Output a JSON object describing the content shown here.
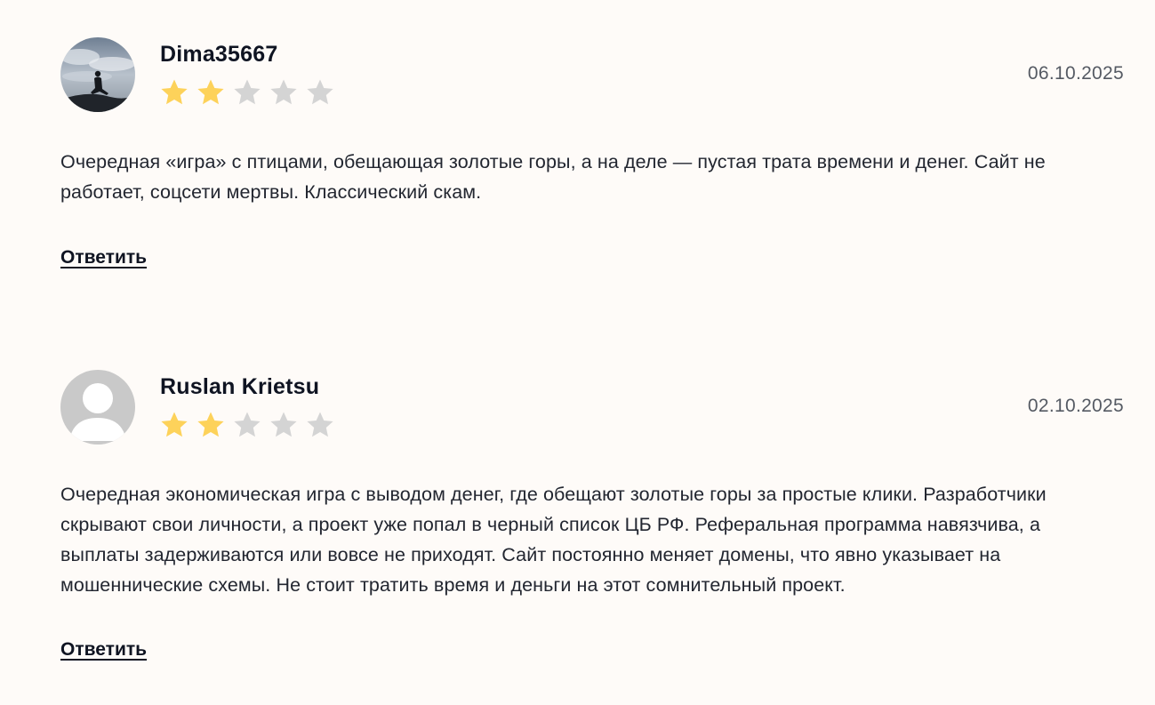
{
  "colors": {
    "background": "#fefbf8",
    "star_filled": "#fdd25a",
    "star_empty": "#d4d4d4",
    "text": "#222630",
    "date": "#555a63"
  },
  "reviews": [
    {
      "author": "Dima35667",
      "avatar": "photo-avatar",
      "rating": 2,
      "max_rating": 5,
      "date": "06.10.2025",
      "text": "Очередная «игра» с птицами, обещающая золотые горы, а на деле — пустая трата времени и денег. Сайт не работает, соцсети мертвы. Классический скам.",
      "reply_label": "Ответить"
    },
    {
      "author": "Ruslan Krietsu",
      "avatar": "default-user-avatar",
      "rating": 2,
      "max_rating": 5,
      "date": "02.10.2025",
      "text": "Очередная экономическая игра с выводом денег, где обещают золотые горы за простые клики. Разработчики скрывают свои личности, а проект уже попал в черный список ЦБ РФ. Реферальная программа навязчива, а выплаты задерживаются или вовсе не приходят. Сайт постоянно меняет домены, что явно указывает на мошеннические схемы. Не стоит тратить время и деньги на этот сомнительный проект.",
      "reply_label": "Ответить"
    }
  ]
}
